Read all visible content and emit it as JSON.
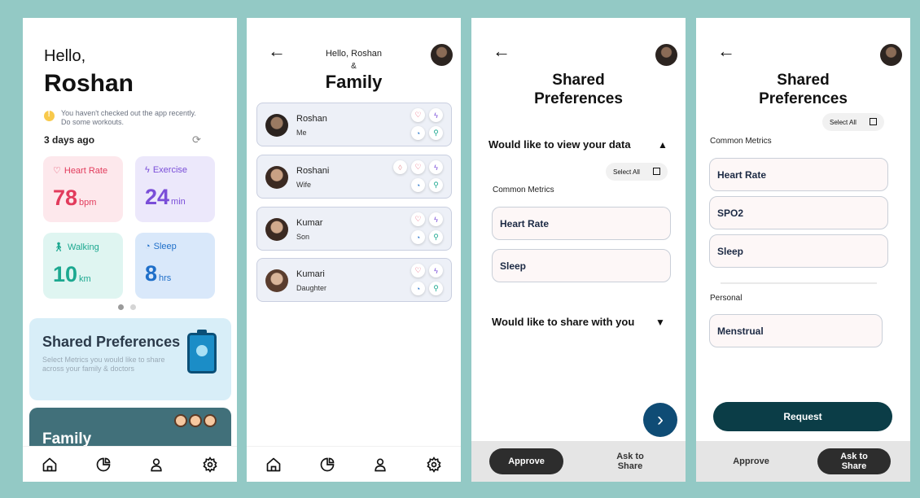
{
  "home": {
    "greeting": "Hello,",
    "user_name": "Roshan",
    "warning_text": "You haven't checked out the app recently. Do some workouts.",
    "last_seen": "3 days ago",
    "stats": {
      "heart_rate": {
        "label": "Heart Rate",
        "value": "78",
        "unit": "bpm"
      },
      "exercise": {
        "label": "Exercise",
        "value": "24",
        "unit": "min"
      },
      "walking": {
        "label": "Walking",
        "value": "10",
        "unit": "km"
      },
      "sleep": {
        "label": "Sleep",
        "value": "8",
        "unit": "hrs"
      }
    },
    "shared_card": {
      "title": "Shared Preferences",
      "subtitle": "Select Metrics you would like to share across your family & doctors"
    },
    "family_card": {
      "title": "Family"
    }
  },
  "family": {
    "hello": "Hello, Roshan",
    "amp": "&",
    "title": "Family",
    "members": [
      {
        "name": "Roshan",
        "role": "Me"
      },
      {
        "name": "Roshani",
        "role": "Wife"
      },
      {
        "name": "Kumar",
        "role": "Son"
      },
      {
        "name": "Kumari",
        "role": "Daughter"
      }
    ]
  },
  "shared1": {
    "title": "Shared Preferences",
    "view_section": "Would like to view your data",
    "select_all": "Select All",
    "common_metrics": "Common Metrics",
    "metrics": [
      "Heart Rate",
      "Sleep"
    ],
    "share_section": "Would like to share with you",
    "approve": "Approve",
    "ask_to_share": "Ask to Share"
  },
  "shared2": {
    "title": "Shared Preferences",
    "select_all": "Select All",
    "common_metrics": "Common Metrics",
    "metrics": [
      "Heart Rate",
      "SPO2",
      "Sleep"
    ],
    "personal_label": "Personal",
    "personal_metrics": [
      "Menstrual"
    ],
    "request": "Request",
    "approve": "Approve",
    "ask_to_share": "Ask to Share"
  },
  "colors": {
    "background": "#93c9c5",
    "heart": "#e23b5c",
    "exercise": "#7a4ed8",
    "walking": "#1ca890",
    "sleep": "#1f6fc9",
    "primary_dark": "#0b3d47"
  },
  "icons": {
    "tabbar": [
      "home-icon",
      "chart-icon",
      "user-icon",
      "settings-icon"
    ]
  }
}
